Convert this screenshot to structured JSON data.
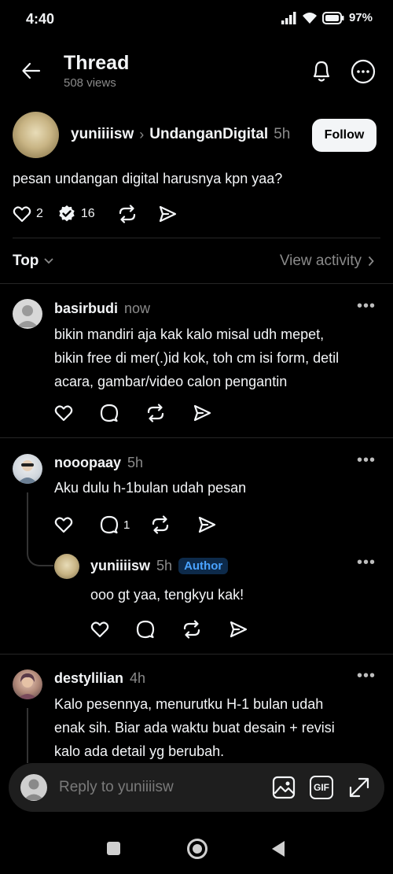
{
  "status": {
    "time": "4:40",
    "battery": "97%"
  },
  "header": {
    "title": "Thread",
    "views": "508 views"
  },
  "post": {
    "author": "yuniiiisw",
    "community": "UndanganDigital",
    "time": "5h",
    "follow_label": "Follow",
    "text": "pesan undangan digital harusnya kpn yaa?",
    "likes": "2",
    "reposts": "16"
  },
  "sort": {
    "label": "Top",
    "view_activity": "View activity"
  },
  "replies": [
    {
      "user": "basirbudi",
      "time": "now",
      "lines": [
        "bikin mandiri aja kak kalo misal udh mepet,",
        "bikin free di mer(.)id kok,  toh cm isi form, detil",
        "acara, gambar/video calon pengantin"
      ]
    },
    {
      "user": "nooopaay",
      "time": "5h",
      "text": "Aku dulu h-1bulan udah pesan",
      "comments": "1"
    },
    {
      "user": "yuniiiisw",
      "time": "5h",
      "badge": "Author",
      "text": "ooo gt yaa, tengkyu kak!"
    },
    {
      "user": "destylilian",
      "time": "4h",
      "lines": [
        "Kalo pesennya, menurutku H-1 bulan udah",
        "enak sih. Biar ada waktu buat desain + revisi",
        "kalo ada detail yg berubah."
      ]
    }
  ],
  "composer": {
    "placeholder": "Reply to yuniiiisw",
    "gif_label": "GIF"
  },
  "icons": [
    "back-arrow-icon",
    "bell-icon",
    "more-icon",
    "heart-icon",
    "comment-icon",
    "repost-icon",
    "share-icon",
    "image-icon",
    "gif-icon",
    "expand-icon"
  ]
}
